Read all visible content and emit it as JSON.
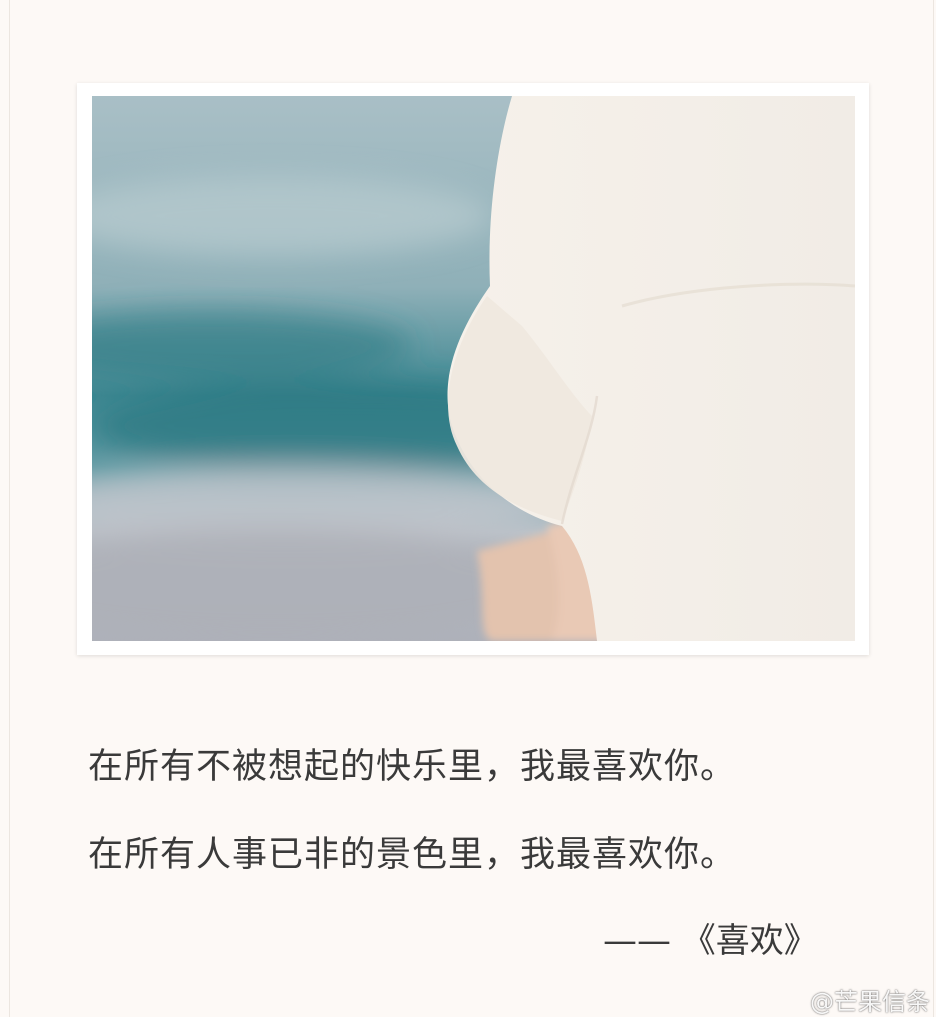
{
  "poem": {
    "line_1": "在所有不被想起的快乐里，我最喜欢你。",
    "line_2": "在所有人事已非的景色里，我最喜欢你。",
    "attribution": "—— 《喜欢》"
  },
  "watermark": "@芒果信条",
  "photo": {
    "description_icon": "photo-image",
    "colors": {
      "sea_light": "#9fb9bf",
      "sea_dark": "#2f7d86",
      "shore": "#b7b6bd",
      "shirt": "#f4efe8",
      "skin": "#e2c1ad"
    }
  }
}
